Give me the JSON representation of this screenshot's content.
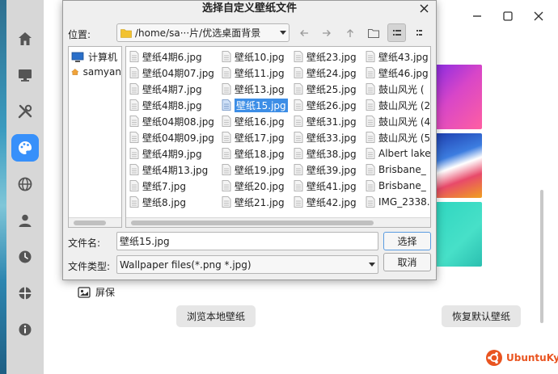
{
  "dialog": {
    "title": "选择自定义壁纸文件",
    "location_label": "位置:",
    "path": "/home/sa···片/优选桌面背景",
    "places": [
      {
        "label": "计算机",
        "icon": "computer-icon"
      },
      {
        "label": "samyan",
        "icon": "home-folder-icon"
      }
    ],
    "columns": [
      [
        "壁纸4期6.jpg",
        "壁纸04期07.jpg",
        "壁纸4期7.jpg",
        "壁纸4期8.jpg",
        "壁纸04期08.jpg",
        "壁纸04期09.jpg",
        "壁纸4期9.jpg",
        "壁纸4期13.jpg",
        "壁纸7.jpg",
        "壁纸8.jpg"
      ],
      [
        "壁纸10.jpg",
        "壁纸11.jpg",
        "壁纸13.jpg",
        "壁纸15.jpg",
        "壁纸16.jpg",
        "壁纸17.jpg",
        "壁纸18.jpg",
        "壁纸19.jpg",
        "壁纸20.jpg",
        "壁纸21.jpg"
      ],
      [
        "壁纸23.jpg",
        "壁纸24.jpg",
        "壁纸25.jpg",
        "壁纸26.jpg",
        "壁纸31.jpg",
        "壁纸33.jpg",
        "壁纸38.jpg",
        "壁纸39.jpg",
        "壁纸41.jpg",
        "壁纸42.jpg"
      ],
      [
        "壁纸43.jpg",
        "壁纸46.jpg",
        "鼓山风光 (",
        "鼓山风光 (2",
        "鼓山风光 (4",
        "鼓山风光 (5",
        "Albert lake",
        "Brisbane_",
        "Brisbane_",
        "IMG_2338."
      ]
    ],
    "selected_file": "壁纸15.jpg",
    "filename_label": "文件名:",
    "filename_value": "壁纸15.jpg",
    "filetype_label": "文件类型:",
    "filetype_value": "Wallpaper files(*.png *.jpg)",
    "ok_label": "选择",
    "cancel_label": "取消"
  },
  "settings": {
    "screensaver_label": "屏保",
    "browse_button": "浏览本地壁纸",
    "reset_button": "恢复默认壁纸",
    "active_nav": "personalize"
  },
  "watermark": {
    "text": "UbuntuKylin"
  },
  "colors": {
    "accent": "#3790fa",
    "selection": "#3d8ee6",
    "brand": "#e95420"
  }
}
